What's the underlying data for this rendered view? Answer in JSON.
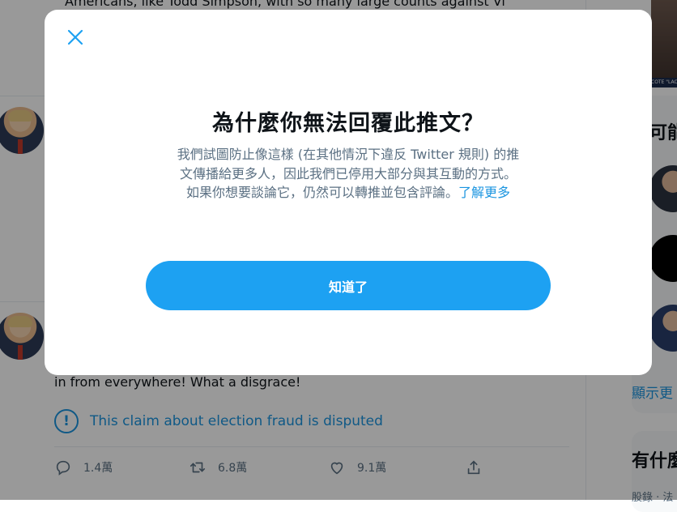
{
  "timeline": {
    "top_text_cut": "Americans, like Todd Simpson, with so many large counts against Vi",
    "tweet_text": "in from everywhere! What a disgrace!",
    "notice_text": "This claim about election fraud is disputed",
    "notice_icon": "exclamation-circle-icon",
    "actions": {
      "reply_count": "1.4萬",
      "retweet_count": "6.8萬",
      "like_count": "9.1萬"
    }
  },
  "sidebar": {
    "video_caption": "COTE \"LACK O",
    "who_to_follow_head": "可能",
    "show_more": "顯示更",
    "whats_happening_head": "有什麼",
    "bottom_cut": "股錄 · 法"
  },
  "modal": {
    "title": "為什麼你無法回覆此推文？",
    "body_line1": "我們試圖防止像這樣 (在其他情況下違反 Twitter 規則) 的推",
    "body_line2": "文傳播給更多人，因此我們已停用大部分與其互動的方式。",
    "body_line3": "如果你想要談論它，仍然可以轉推並包含評論。",
    "learn_more": "了解更多",
    "button_label": "知道了"
  },
  "colors": {
    "accent": "#1da1f2",
    "link": "#1b95e0",
    "secondary_text": "#5b7083",
    "overlay": "rgba(0,0,0,0.40)"
  }
}
